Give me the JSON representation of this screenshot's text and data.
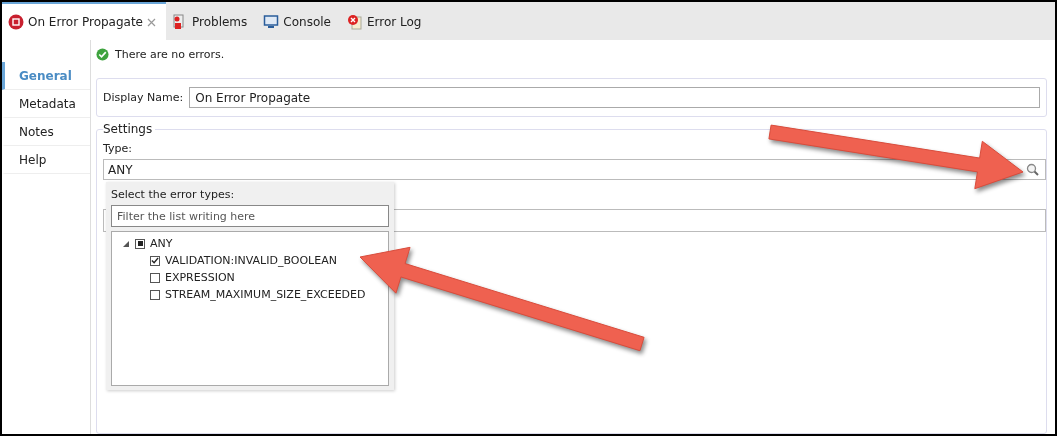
{
  "tabs": [
    {
      "label": "On Error Propagate",
      "selected": true,
      "closable": true,
      "kind": "flow"
    },
    {
      "label": "Problems",
      "selected": false,
      "closable": false,
      "kind": "problems"
    },
    {
      "label": "Console",
      "selected": false,
      "closable": false,
      "kind": "console"
    },
    {
      "label": "Error Log",
      "selected": false,
      "closable": false,
      "kind": "errorlog"
    }
  ],
  "sidebar": {
    "items": [
      {
        "label": "General",
        "selected": true
      },
      {
        "label": "Metadata",
        "selected": false
      },
      {
        "label": "Notes",
        "selected": false
      },
      {
        "label": "Help",
        "selected": false
      }
    ]
  },
  "status": "There are no errors.",
  "display_name": {
    "label": "Display Name:",
    "value": "On Error Propagate"
  },
  "settings": {
    "legend": "Settings",
    "type_label": "Type:",
    "type_value": "ANY"
  },
  "popup": {
    "title": "Select the error types:",
    "filter_placeholder": "Filter the list writing here",
    "tree": [
      {
        "label": "ANY",
        "expanded": true,
        "mixed": true,
        "children": [
          {
            "label": "VALIDATION:INVALID_BOOLEAN",
            "checked": true
          },
          {
            "label": "EXPRESSION",
            "checked": false
          },
          {
            "label": "STREAM_MAXIMUM_SIZE_EXCEEDED",
            "checked": false
          }
        ]
      }
    ]
  }
}
